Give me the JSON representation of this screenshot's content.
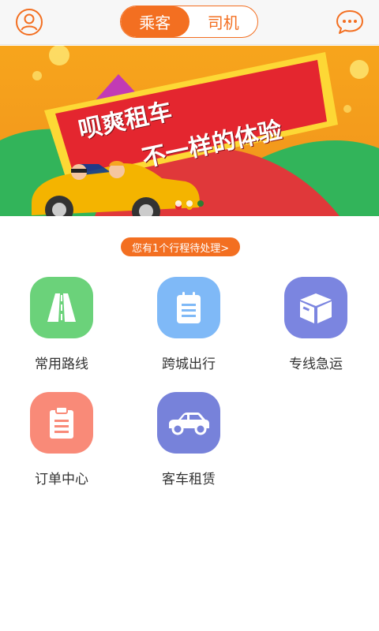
{
  "header": {
    "tabs": [
      {
        "label": "乘客",
        "active": true
      },
      {
        "label": "司机",
        "active": false
      }
    ],
    "accent_color": "#f36f21",
    "left_icon": "user-icon",
    "right_icon": "chat-icon"
  },
  "banner": {
    "line1": "呗爽租车",
    "line2": "不一样的体验",
    "slide_count": 3,
    "active_slide": 2
  },
  "pending_notice": "您有1个行程待处理>",
  "features": [
    {
      "label": "常用路线",
      "icon": "road-icon",
      "color": "#6bd27a"
    },
    {
      "label": "跨城出行",
      "icon": "notepad-icon",
      "color": "#7fb9f7"
    },
    {
      "label": "专线急运",
      "icon": "box-icon",
      "color": "#7b85e0"
    },
    {
      "label": "订单中心",
      "icon": "clipboard-icon",
      "color": "#f98a78"
    },
    {
      "label": "客车租赁",
      "icon": "car-icon",
      "color": "#7782da"
    }
  ]
}
